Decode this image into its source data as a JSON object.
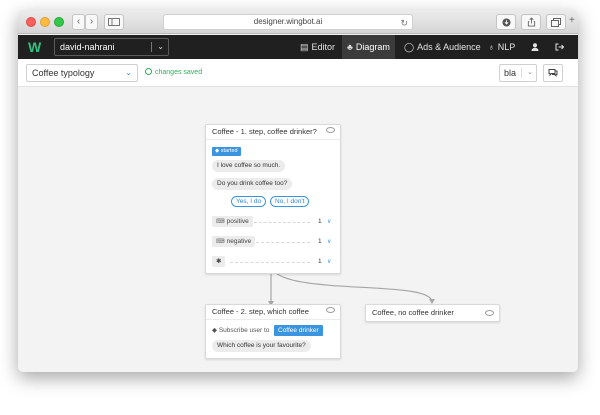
{
  "browser": {
    "url": "designer.wingbot.ai",
    "back_icon": "chevron-left-icon",
    "forward_icon": "chevron-right-icon"
  },
  "navbar": {
    "logo": "W",
    "project": "david-nahrani",
    "items": [
      {
        "label": "Editor",
        "icon": "editor-icon"
      },
      {
        "label": "Diagram",
        "icon": "diagram-icon",
        "active": true
      },
      {
        "label": "Ads & Audience",
        "icon": "chat-icon"
      },
      {
        "label": "NLP",
        "icon": "lightbulb-icon"
      }
    ]
  },
  "toolbar": {
    "typology": "Coffee typology",
    "status": "changes saved",
    "language": "bla"
  },
  "nodes": {
    "step1": {
      "title": "Coffee - 1. step, coffee drinker?",
      "tag": "started",
      "messages": [
        "I love coffee so much.",
        "Do you drink coffee too?"
      ],
      "quick_replies": [
        "Yes, I do",
        "No, I don't"
      ],
      "intents": [
        {
          "label": "positive",
          "count": "1"
        },
        {
          "label": "negative",
          "count": "1"
        },
        {
          "label": "✱",
          "count": "1"
        }
      ]
    },
    "step2": {
      "title": "Coffee - 2. step, which coffee",
      "subscribe_text": "Subscribe user to",
      "subscribe_tag": "Coffee drinker",
      "message": "Which coffee is your favourite?"
    },
    "no_drinker": {
      "title": "Coffee, no coffee drinker"
    }
  },
  "colors": {
    "accent": "#3a94e0",
    "brand": "#2fc27e",
    "saved": "#2fae5a",
    "navbar": "#202020"
  }
}
